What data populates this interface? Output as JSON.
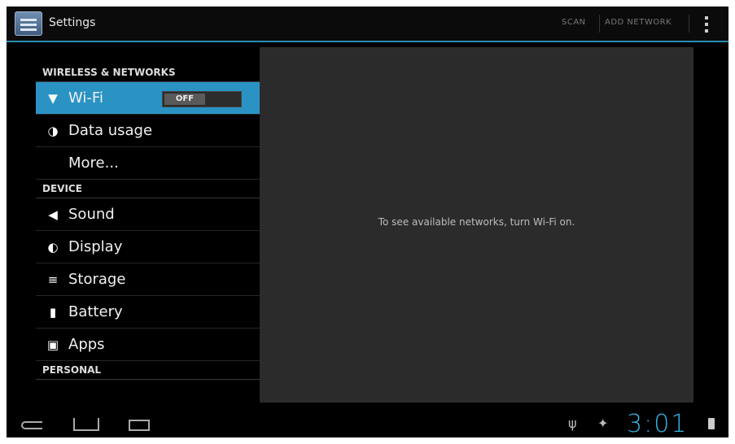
{
  "actionbar": {
    "title": "Settings",
    "actions": {
      "scan": "SCAN",
      "add_network": "ADD NETWORK"
    },
    "icons": {
      "app": "settings-app-icon",
      "overflow": "overflow-menu-icon"
    }
  },
  "sections": [
    {
      "header": "WIRELESS & NETWORKS",
      "items": [
        {
          "label": "Wi-Fi",
          "icon": "wifi-icon",
          "selected": true,
          "toggle": "OFF"
        },
        {
          "label": "Data usage",
          "icon": "data-usage-icon"
        },
        {
          "label": "More...",
          "icon": ""
        }
      ]
    },
    {
      "header": "DEVICE",
      "items": [
        {
          "label": "Sound",
          "icon": "sound-icon"
        },
        {
          "label": "Display",
          "icon": "display-icon"
        },
        {
          "label": "Storage",
          "icon": "storage-icon"
        },
        {
          "label": "Battery",
          "icon": "battery-icon"
        },
        {
          "label": "Apps",
          "icon": "apps-icon"
        }
      ]
    },
    {
      "header": "PERSONAL",
      "items": []
    }
  ],
  "detail": {
    "message": "To see available networks, turn Wi-Fi on."
  },
  "statusbar": {
    "time": "3:01"
  },
  "colors": {
    "accent": "#33b5e5",
    "selected_row": "#2a93c4",
    "detail_bg": "#2b2b2b"
  }
}
